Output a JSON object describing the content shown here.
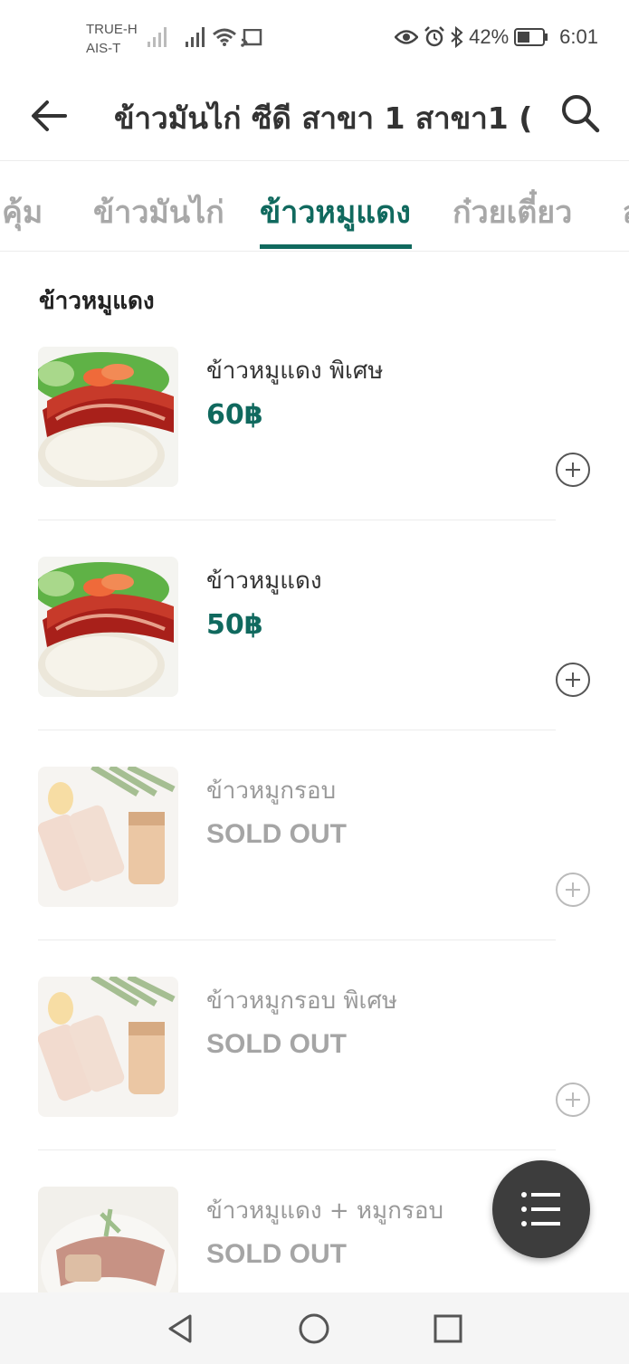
{
  "status_bar": {
    "carrier_1": "TRUE-H",
    "carrier_2": "AIS-T",
    "battery": "42%",
    "time": "6:01",
    "icons": [
      "signal-icon",
      "signal-icon",
      "wifi-icon",
      "cast-icon",
      "eye-icon",
      "alarm-icon",
      "bluetooth-icon",
      "battery-icon"
    ]
  },
  "app_bar": {
    "title": "ข้าวมันไก่ ซีดี สาขา 1 สาขา1 (...",
    "back_icon": "arrow-left-icon",
    "search_icon": "search-icon"
  },
  "tabs": [
    {
      "label": "ดคุ้ม"
    },
    {
      "label": "ข้าวมันไก่"
    },
    {
      "label": "ข้าวหมูแดง",
      "active": true
    },
    {
      "label": "ก๋วยเตี๋ยว"
    },
    {
      "label": "ส"
    }
  ],
  "section": {
    "title": "ข้าวหมูแดง"
  },
  "menu_items": [
    {
      "name": "ข้าวหมูแดง พิเศษ",
      "price": "60฿",
      "sold_out": false
    },
    {
      "name": "ข้าวหมูแดง",
      "price": "50฿",
      "sold_out": false
    },
    {
      "name": "ข้าวหมูกรอบ",
      "price": "SOLD OUT",
      "sold_out": true
    },
    {
      "name": "ข้าวหมูกรอบ พิเศษ",
      "price": "SOLD OUT",
      "sold_out": true
    },
    {
      "name": "ข้าวหมูแดง + หมูกรอบ",
      "price": "SOLD OUT",
      "sold_out": true
    }
  ],
  "fab": {
    "icon": "list-icon"
  },
  "nav_bar": {
    "icons": [
      "nav-back-icon",
      "nav-home-icon",
      "nav-recents-icon"
    ]
  },
  "colors": {
    "accent": "#10695e",
    "fab": "#3d3d3d",
    "inactive_tab": "#a8a8a8"
  }
}
